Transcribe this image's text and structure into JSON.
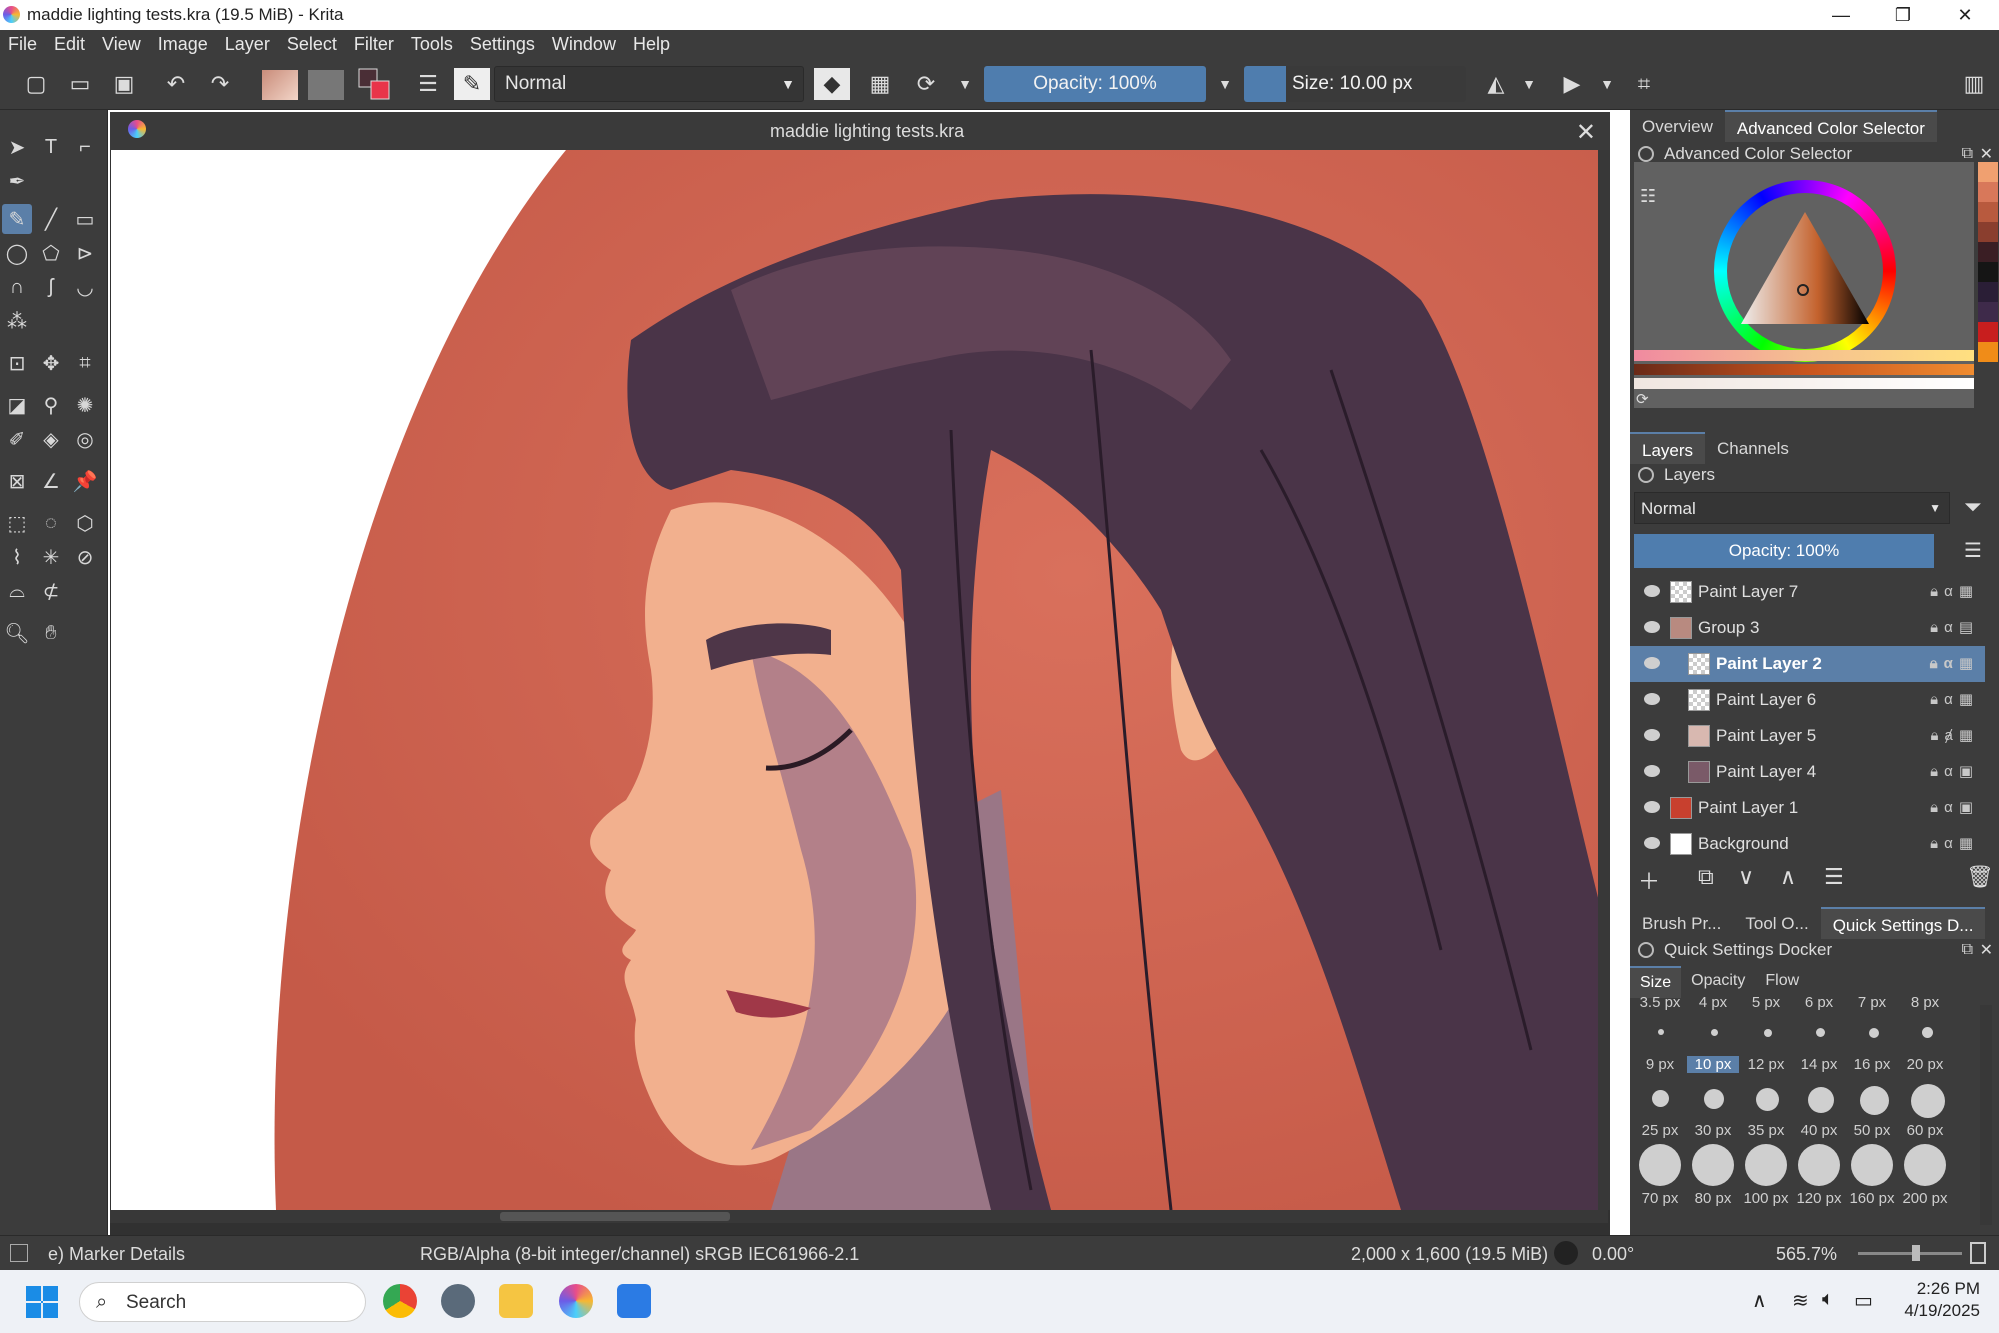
{
  "window": {
    "title": "maddie lighting tests.kra (19.5 MiB) - Krita",
    "minimize": "—",
    "maximize": "❐",
    "close": "✕"
  },
  "menu": [
    "File",
    "Edit",
    "View",
    "Image",
    "Layer",
    "Select",
    "Filter",
    "Tools",
    "Settings",
    "Window",
    "Help"
  ],
  "toolbar": {
    "blend_mode": "Normal",
    "opacity_label": "Opacity: 100%",
    "size_label": "Size: 10.00 px"
  },
  "document": {
    "title": "maddie lighting tests.kra",
    "close": "✕"
  },
  "color_dock": {
    "tabs": [
      "Overview",
      "Advanced Color Selector"
    ],
    "header": "Advanced Color Selector",
    "swatches": [
      "#f0a070",
      "#d8785a",
      "#b85a3e",
      "#8a3e2e",
      "#3a1e24",
      "#151515",
      "#2a1e36",
      "#3e2a4a",
      "#c81e1e",
      "#f08c18"
    ]
  },
  "layers_dock": {
    "tabs": [
      "Layers",
      "Channels"
    ],
    "header": "Layers",
    "blend_mode": "Normal",
    "opacity_label": "Opacity:  100%",
    "layers": [
      {
        "name": "Paint Layer 7",
        "selected": false
      },
      {
        "name": "Group 3",
        "selected": false
      },
      {
        "name": "Paint Layer 2",
        "selected": true
      },
      {
        "name": "Paint Layer 6",
        "selected": false
      },
      {
        "name": "Paint Layer 5",
        "selected": false
      },
      {
        "name": "Paint Layer 4",
        "selected": false
      },
      {
        "name": "Paint Layer 1",
        "selected": false
      },
      {
        "name": "Background",
        "selected": false
      }
    ]
  },
  "quick_settings": {
    "dock_tabs": [
      "Brush Pr...",
      "Tool O...",
      "Quick Settings D..."
    ],
    "header": "Quick Settings Docker",
    "tabs": [
      "Size",
      "Opacity",
      "Flow"
    ],
    "sizes_row0": [
      "3.5 px",
      "4 px",
      "5 px",
      "6 px",
      "7 px",
      "8 px"
    ],
    "sizes_row1": [
      "9 px",
      "10 px",
      "12 px",
      "14 px",
      "16 px",
      "20 px"
    ],
    "sizes_row2": [
      "25 px",
      "30 px",
      "35 px",
      "40 px",
      "50 px",
      "60 px"
    ],
    "sizes_row3": [
      "70 px",
      "80 px",
      "100 px",
      "120 px",
      "160 px",
      "200 px"
    ],
    "selected_size": "10 px"
  },
  "status": {
    "brush": "e) Marker Details",
    "color_space": "RGB/Alpha (8-bit integer/channel)  sRGB IEC61966-2.1",
    "dimensions": "2,000 x 1,600 (19.5 MiB)",
    "rotation": "0.00°",
    "zoom": "565.7%"
  },
  "taskbar": {
    "search_placeholder": "Search",
    "time": "2:26 PM",
    "date": "4/19/2025"
  }
}
